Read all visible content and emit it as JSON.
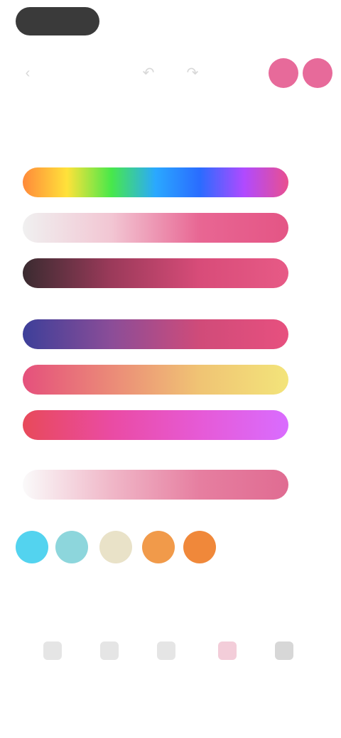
{
  "header": {
    "pill_label": ""
  },
  "toolbar": {
    "icons": [
      {
        "name": "back-icon",
        "glyph": "‹"
      },
      {
        "name": "undo-icon",
        "glyph": "↶"
      },
      {
        "name": "redo-icon",
        "glyph": "↷"
      }
    ],
    "accent_colors": [
      "#e76a9a",
      "#e76a9a"
    ]
  },
  "section": {
    "left_label": "",
    "right_label": ""
  },
  "gradients": [
    {
      "name": "rainbow",
      "colors": [
        "#ff8a3a",
        "#ffe23a",
        "#48e84a",
        "#2aa8ff",
        "#2a6cff",
        "#b04aff",
        "#e94f8f"
      ],
      "value": ""
    },
    {
      "name": "light-to-pink",
      "colors": [
        "#f0f0f0",
        "#f2c6d3",
        "#e86693",
        "#e45585"
      ],
      "value": ""
    },
    {
      "name": "dark-to-pink",
      "colors": [
        "#3a2b30",
        "#9b3a5a",
        "#d84c79",
        "#e75a86"
      ],
      "value": ""
    },
    {
      "name": "purple-to-pink",
      "colors": [
        "#3d3f99",
        "#8b4d98",
        "#d04b79",
        "#e7507f"
      ],
      "value": ""
    },
    {
      "name": "pink-to-yellow",
      "colors": [
        "#e5507c",
        "#eb8a78",
        "#f0c474",
        "#f3e47a"
      ],
      "value": ""
    },
    {
      "name": "red-to-magenta",
      "colors": [
        "#e84a5a",
        "#ea4ba3",
        "#e65ad6",
        "#d96cff"
      ],
      "value": ""
    },
    {
      "name": "soft-pink",
      "colors": [
        "#fafafa",
        "#f0b7c8",
        "#e67ea0",
        "#e06c92"
      ],
      "value": ""
    }
  ],
  "swatches": [
    {
      "name": "swatch-cyan",
      "color": "#53d3ef"
    },
    {
      "name": "swatch-teal",
      "color": "#8dd6dc"
    },
    {
      "name": "swatch-beige",
      "color": "#e9e2c8"
    },
    {
      "name": "swatch-orange",
      "color": "#f19a4a"
    },
    {
      "name": "swatch-orange-2",
      "color": "#f0883a"
    }
  ],
  "nav": [
    {
      "name": "nav-item-1",
      "label": ""
    },
    {
      "name": "nav-item-2",
      "label": ""
    },
    {
      "name": "nav-item-3",
      "label": ""
    },
    {
      "name": "nav-item-4",
      "label": ""
    },
    {
      "name": "nav-item-5",
      "label": ""
    }
  ]
}
